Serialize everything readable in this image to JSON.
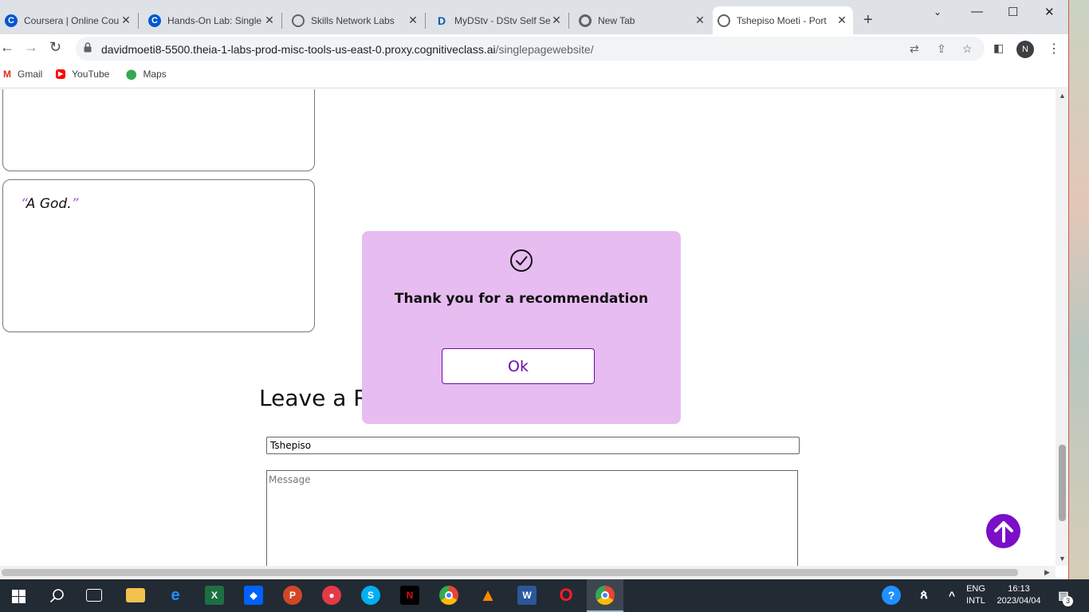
{
  "browser": {
    "tabs": [
      {
        "title": "Coursera | Online Cou",
        "icon": "coursera-icon",
        "color": "#0056d2"
      },
      {
        "title": "Hands-On Lab: Single",
        "icon": "coursera-icon",
        "color": "#0056d2"
      },
      {
        "title": "Skills Network Labs",
        "icon": "globe-icon",
        "color": "#5f6368"
      },
      {
        "title": "MyDStv - DStv Self Se",
        "icon": "dstv-icon",
        "color": "#0b5ca8"
      },
      {
        "title": "New Tab",
        "icon": "chrome-icon",
        "color": "#5f6368"
      },
      {
        "title": "Tshepiso Moeti - Port",
        "icon": "globe-icon",
        "color": "#5f6368"
      }
    ],
    "url_host": "davidmoeti8-5500.theia-1-labs-prod-misc-tools-us-east-0.proxy.cognitiveclass.ai",
    "url_path": "/singlepagewebsite/",
    "profile_initial": "N",
    "bookmarks": [
      {
        "label": "Gmail",
        "icon": "gmail-icon"
      },
      {
        "label": "YouTube",
        "icon": "youtube-icon"
      },
      {
        "label": "Maps",
        "icon": "maps-icon"
      }
    ]
  },
  "page": {
    "quote_text": "A God.",
    "open_quote": "“",
    "close_quote": "”",
    "section_title": "Leave a R",
    "name_value": "Tshepiso",
    "message_placeholder": "Message"
  },
  "modal": {
    "message": "Thank you for a recommendation",
    "ok_label": "Ok",
    "bg_color": "#e7bcf0",
    "accent_color": "#6a0dad"
  },
  "taskbar": {
    "lang_line1": "ENG",
    "lang_line2": "INTL",
    "time": "16:13",
    "date": "2023/04/04",
    "notification_count": "3"
  }
}
